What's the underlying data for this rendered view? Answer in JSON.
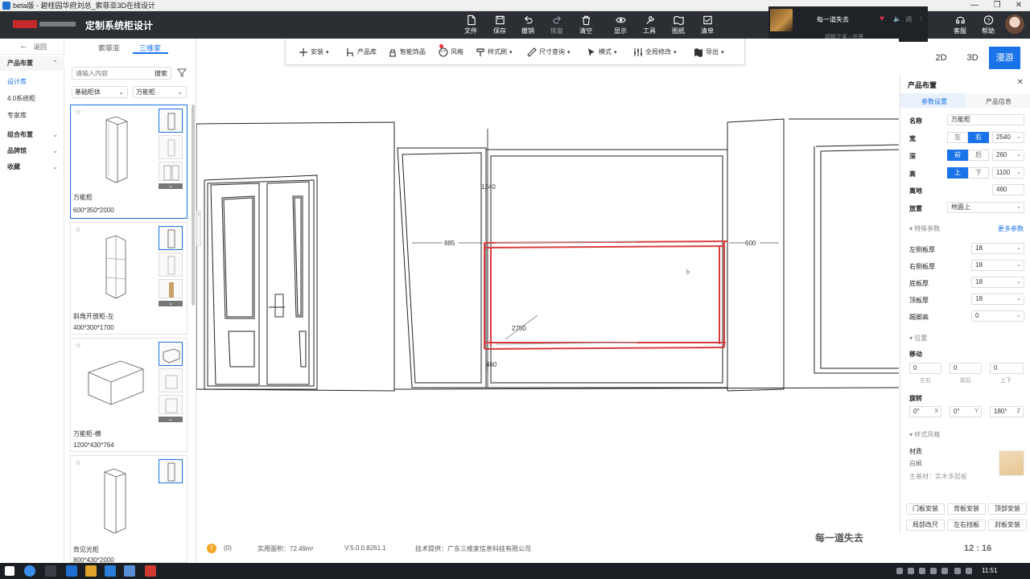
{
  "window": {
    "title": "beta版 - 碧桂园华府刘总_索菲亚3D在线设计",
    "controls": [
      "—",
      "❐",
      "✕"
    ]
  },
  "header": {
    "app_title": "定制系统柜设计",
    "tools": [
      {
        "label": "文件",
        "icon": "file-icon"
      },
      {
        "label": "保存",
        "icon": "save-icon"
      },
      {
        "label": "撤销",
        "icon": "undo-icon"
      },
      {
        "label": "恢复",
        "icon": "redo-icon",
        "disabled": true
      },
      {
        "label": "清空",
        "icon": "clear-icon"
      },
      {
        "label": "显示",
        "icon": "eye-icon"
      },
      {
        "label": "工具",
        "icon": "wrench-icon"
      },
      {
        "label": "图纸",
        "icon": "drawing-icon"
      },
      {
        "label": "清单",
        "icon": "checklist-icon"
      }
    ],
    "right": [
      {
        "label": "客服",
        "icon": "headset-icon"
      },
      {
        "label": "帮助",
        "icon": "help-icon"
      }
    ]
  },
  "media": {
    "song": "每一道失去",
    "artist": "胡智之羊 - 许恩"
  },
  "left_nav": {
    "back_label": "返回",
    "items": [
      {
        "label": "产品布置",
        "type": "head",
        "chev": "⌃"
      },
      {
        "label": "设计库",
        "type": "active"
      },
      {
        "label": "4.0系统柜",
        "type": "normal"
      },
      {
        "label": "专家库",
        "type": "normal"
      },
      {
        "label": "组合布置",
        "type": "head",
        "chev": "⌄"
      },
      {
        "label": "品牌馆",
        "type": "head",
        "chev": "⌄"
      },
      {
        "label": "收藏",
        "type": "head",
        "chev": "⌄"
      }
    ]
  },
  "library": {
    "tabs": [
      "索菲亚",
      "三维家"
    ],
    "active_tab": 1,
    "search_placeholder": "请输入内容",
    "search_button": "搜索",
    "filter_category": "基础柜体",
    "filter_type": "万能柜",
    "products": [
      {
        "name": "万能柜",
        "dims": "600*350*2000"
      },
      {
        "name": "斜角开放柜-左",
        "dims": "400*300*1700"
      },
      {
        "name": "万能柜-横",
        "dims": "1200*430*764"
      },
      {
        "name": "背见光柜",
        "dims": "800*430*2000"
      }
    ]
  },
  "viewport_toolbar": {
    "items": [
      {
        "label": "安装",
        "dropdown": true
      },
      {
        "label": "产品库",
        "dropdown": false
      },
      {
        "label": "智能饰品",
        "dropdown": false,
        "badge": true
      },
      {
        "label": "风格",
        "dropdown": false
      },
      {
        "label": "样式刷",
        "dropdown": true
      },
      {
        "label": "尺寸查询",
        "dropdown": true
      },
      {
        "label": "模式",
        "dropdown": true
      },
      {
        "label": "全局修改",
        "dropdown": true
      },
      {
        "label": "导出",
        "dropdown": true
      }
    ]
  },
  "scene_dims": {
    "height": "1240",
    "left_offset": "885",
    "right_offset": "600",
    "width": "2750",
    "floor": "460"
  },
  "view_toggle": {
    "options": [
      "2D",
      "3D",
      "漫游"
    ],
    "active": 2
  },
  "right_panel": {
    "title": "产品布置",
    "tabs": [
      "参数设置",
      "产品信息"
    ],
    "name_label": "名称",
    "name_value": "万能柜",
    "width_label": "宽",
    "width_seg": [
      "左",
      "右"
    ],
    "width_value": "2540",
    "depth_label": "深",
    "depth_seg": [
      "前",
      "后"
    ],
    "depth_value": "260",
    "height_label": "高",
    "height_seg": [
      "上",
      "下"
    ],
    "height_value": "1100",
    "floor_label": "离地",
    "floor_value": "460",
    "place_label": "放置",
    "place_value": "地面上",
    "special_label": "特殊参数",
    "more_label": "更多参数",
    "boards": [
      {
        "label": "左侧板厚",
        "value": "18"
      },
      {
        "label": "右侧板厚",
        "value": "18"
      },
      {
        "label": "底板厚",
        "value": "18"
      },
      {
        "label": "顶板厚",
        "value": "18"
      },
      {
        "label": "踢脚高",
        "value": "0"
      }
    ],
    "position_label": "位置",
    "move_label": "移动",
    "move_values": [
      "0",
      "0",
      "0"
    ],
    "move_subs": [
      "左右",
      "前后",
      "上下"
    ],
    "rotate_label": "旋转",
    "rotate_values": [
      "0°",
      "0°",
      "180°"
    ],
    "rotate_axes": [
      "X",
      "Y",
      "Z"
    ],
    "style_label": "样式风格",
    "material_label": "材质",
    "material_value": "白枫",
    "base_material": "主基材：实木多层板",
    "actions": [
      "门板安装",
      "背板安装",
      "顶部安装",
      "局部改尺",
      "左右挡板",
      "封板安装"
    ]
  },
  "status": {
    "badge_count": "(0)",
    "area": "实用面积：72.49m²",
    "version": "V:5.0.0.8261.1",
    "provider": "技术提供：广东三维家信息科技有限公司"
  },
  "overlay": {
    "watermark": "每一道失去",
    "clock": "12 : 16"
  },
  "taskbar": {
    "time": "11:51"
  }
}
